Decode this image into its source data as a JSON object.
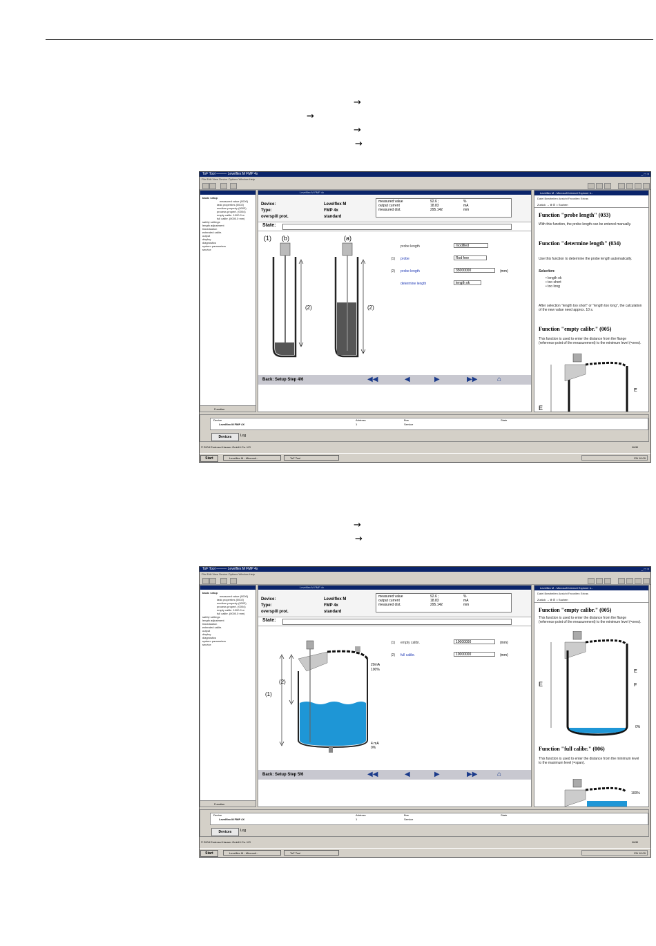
{
  "page": {
    "arrows": [
      "→",
      "→",
      "→",
      "→",
      "→",
      "→"
    ]
  },
  "common": {
    "app_title": "ToF Tool",
    "doc_title": "Levelflex M FMP 4x",
    "menu": "File  Edit  View  Device  Options  Window  Help",
    "tree_items": [
      "basic setup",
      "measured value (0000)",
      "tank properties (0002)",
      "medium property (0003)",
      "process propert. (0004)",
      "empty calibr. 1000.0 m",
      "full calibr. (0000.0 mm)",
      "safety settings",
      "length adjustment",
      "linearisation",
      "extended calibr.",
      "output",
      "display",
      "diagnostics",
      "system parameters",
      "service"
    ],
    "tree_tab": "Function",
    "device_label": "Device:",
    "device_value": "Levelflex M",
    "type_label": "Type:",
    "type_value": "FMP 4x",
    "overspill_label": "overspill prot.",
    "overspill_value": "standard",
    "meas": {
      "r1": [
        "measured value",
        "92.6 ;",
        "%"
      ],
      "r2": [
        "output current",
        "18.83",
        "mA"
      ],
      "r3": [
        "measured dist.",
        "295.142",
        "mm"
      ]
    },
    "state_label": "State:",
    "help_window_title": "Levelflex M - Microsoft Internet Explorer b...",
    "help_menu": "Datei  Bearbeiten  Ansicht  Favoriten  Extras",
    "help_buttons": "Zurück  →  ⊗  ⊡  ⌂  Suchen",
    "dev_cols": [
      "Device",
      "Address",
      "Bus",
      "State"
    ],
    "dev_row": [
      "Levelflex M FMP 4X",
      "1",
      "Service",
      ""
    ],
    "dev_button": "Devices",
    "dev_tab2": "Log",
    "status": "© 2004 Endress+Hauser GmbH+Co. KG",
    "status_right": "NUM",
    "start": "Start",
    "task1": "Levelflex M - Microsof...",
    "task2": "ToF Tool",
    "tray": "EN 10:09"
  },
  "shot1": {
    "nav_label": "Back: Setup Step 4/6",
    "fig_labels": [
      "(1)",
      "(b)",
      "(a)",
      "(2)",
      "(2)"
    ],
    "form": [
      {
        "label": "probe length",
        "prefix": "",
        "value": "modified"
      },
      {
        "label": "probe",
        "prefix": "(1)",
        "value": "Rod free"
      },
      {
        "label": "probe length",
        "prefix": "(2)",
        "value": "35000000",
        "unit": "(mm)"
      },
      {
        "label": "determine length",
        "prefix": "",
        "value": "length ok"
      }
    ],
    "help": {
      "h1": "Function \"probe length\" (033)",
      "p1": "With this function, the probe length can be entered manually.",
      "h2": "Function \"determine length\" (034)",
      "p2": "Use this function to determine the probe length automatically.",
      "sel": "Selection:",
      "opts": [
        "length ok",
        "too short",
        "too long"
      ],
      "p3": "After selection \"length too short\" or \"length too long\", the calculation of the new value need approx. 10 s.",
      "h3": "Function \"empty calibr.\" (005)",
      "p4": "This function is used to enter the distance from the flange (reference point of the measurement) to the minimum level (=zero).",
      "e1": "E",
      "e2": "E"
    }
  },
  "shot2": {
    "nav_label": "Back: Setup Step 5/6",
    "fig_labels": [
      "(1)",
      "(2)",
      "20mA",
      "100%",
      "4 mA",
      "0%"
    ],
    "form": [
      {
        "label": "empty calibr.",
        "prefix": "(1)",
        "value": "10000000",
        "unit": "(mm)"
      },
      {
        "label": "full calibr.",
        "prefix": "(2)",
        "value": "10000000",
        "unit": "(mm)"
      }
    ],
    "help": {
      "h1": "Function \"empty calibr.\" (005)",
      "p1": "This function is used to enter the distance from the flange (reference point of the measurement) to the minimum level (=zero).",
      "h2": "Function \"full calibr.\" (006)",
      "p2": "This function is used to enter the distance from the minimum level to the maximum level (=span).",
      "e1": "E",
      "e2": "E",
      "f": "F",
      "pct0": "0%",
      "pct100": "100%"
    }
  }
}
